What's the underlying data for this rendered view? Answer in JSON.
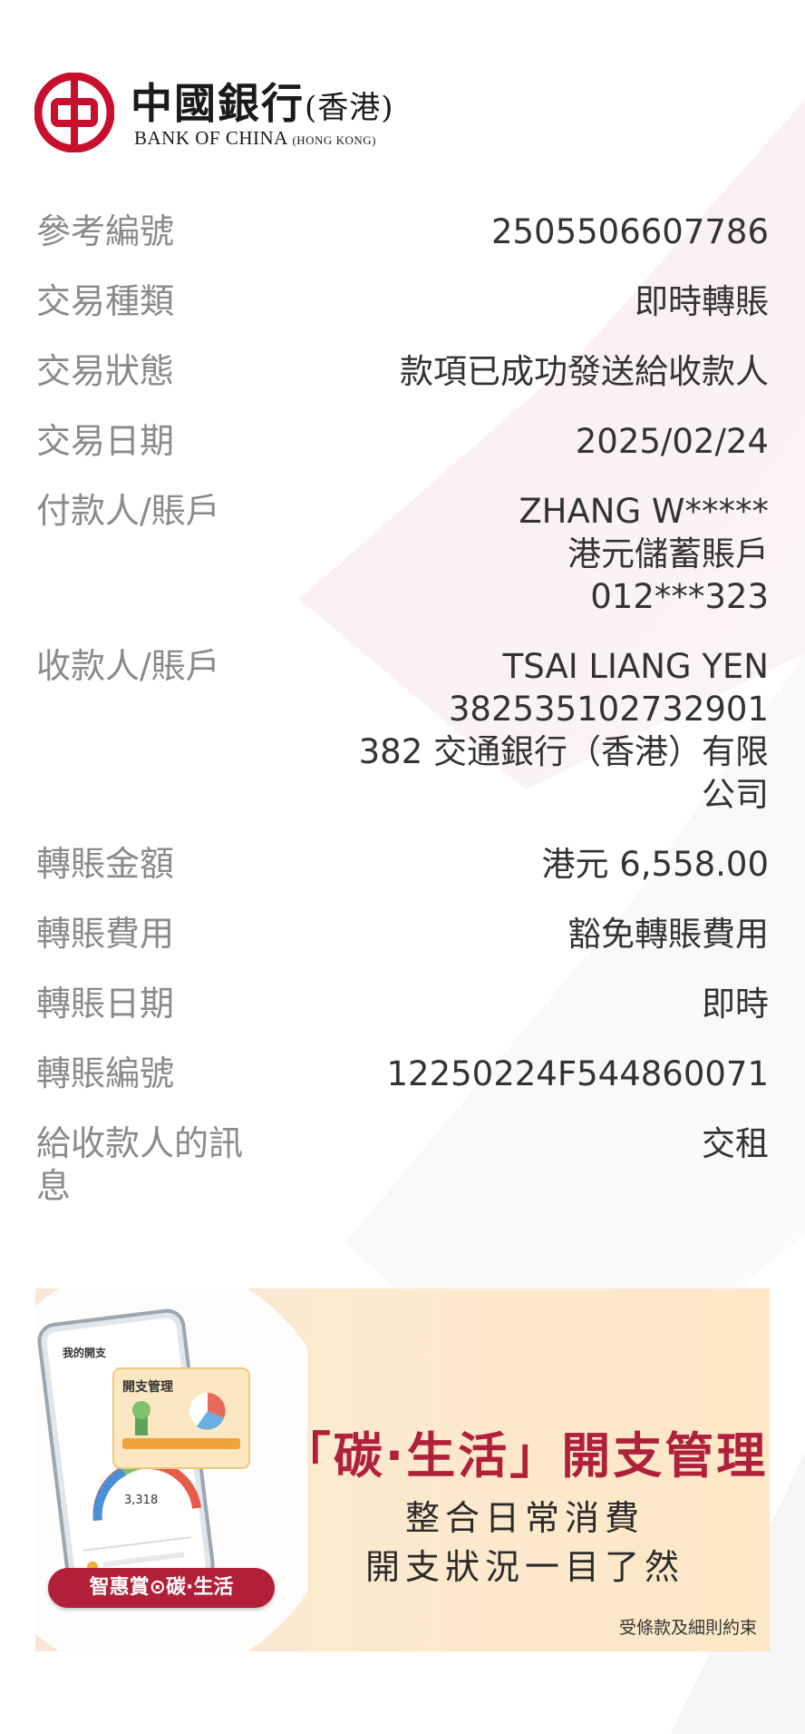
{
  "brand": {
    "name_cn": "中國銀行",
    "name_cn_sub": "(香港)",
    "name_en": "BANK OF CHINA",
    "name_en_sub": "(HONG KONG)",
    "color": "#c8102e"
  },
  "details": [
    {
      "label": "參考編號",
      "values": [
        "2505506607786"
      ]
    },
    {
      "label": "交易種類",
      "values": [
        "即時轉賬"
      ]
    },
    {
      "label": "交易狀態",
      "values": [
        "款項已成功發送給收款人"
      ]
    },
    {
      "label": "交易日期",
      "values": [
        "2025/02/24"
      ]
    },
    {
      "label": "付款人/賬戶",
      "values": [
        "ZHANG W*****",
        "港元儲蓄賬戶",
        "012***323"
      ]
    },
    {
      "label": "收款人/賬戶",
      "values": [
        "TSAI LIANG YEN",
        "382535102732901",
        "382 交通銀行（香港）有限",
        "公司"
      ]
    },
    {
      "label": "轉賬金額",
      "values": [
        "港元 6,558.00"
      ]
    },
    {
      "label": "轉賬費用",
      "values": [
        "豁免轉賬費用"
      ]
    },
    {
      "label": "轉賬日期",
      "values": [
        "即時"
      ]
    },
    {
      "label": "轉賬編號",
      "values": [
        "12250224F544860071"
      ]
    },
    {
      "label": "給收款人的訊息",
      "values": [
        "交租"
      ]
    }
  ],
  "banner": {
    "title": "「碳·生活」開支管理",
    "subtitle1": "整合日常消費",
    "subtitle2": "開支狀況一目了然",
    "tnc": "受條款及細則約束",
    "pill": "智惠賞⊙碳·生活",
    "phone_card_title": "開支管理",
    "phone_heading": "我的開支",
    "phone_amount": "3,318",
    "title_color": "#b1203a",
    "pill_color": "#b21f39"
  }
}
